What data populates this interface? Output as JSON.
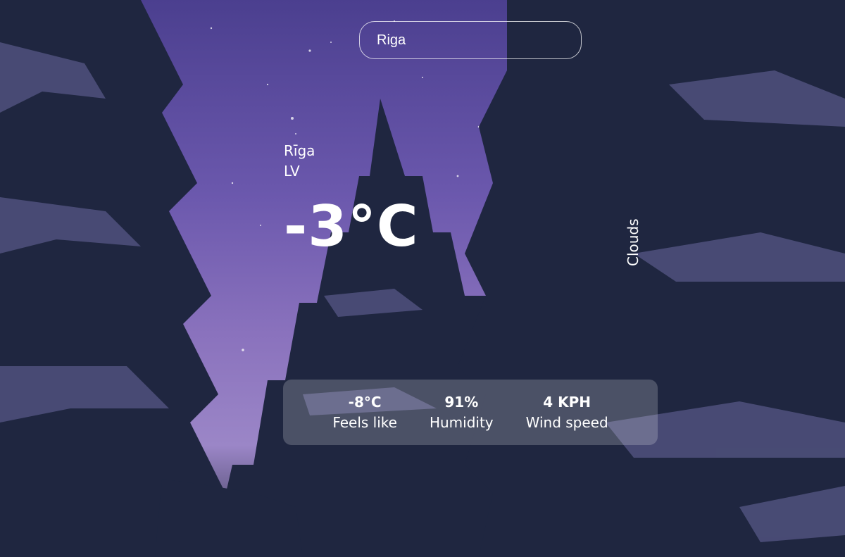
{
  "search": {
    "value": "Riga",
    "placeholder": ""
  },
  "location": {
    "city": "Rīga",
    "country": "LV"
  },
  "weather": {
    "temperature": "-3°C",
    "condition": "Clouds"
  },
  "stats": [
    {
      "value": "-8°C",
      "label": "Feels like"
    },
    {
      "value": "91%",
      "label": "Humidity"
    },
    {
      "value": "4 KPH",
      "label": "Wind speed"
    }
  ],
  "background": {
    "description": "snowy-forest-night",
    "sky_color": "#6b58ad",
    "tree_color": "#1f2640",
    "snow_color": "#7b78b4"
  }
}
